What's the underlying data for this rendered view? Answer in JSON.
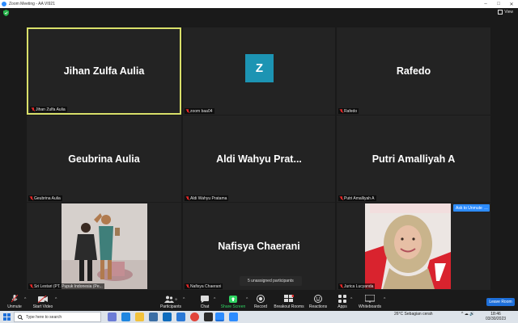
{
  "window": {
    "title": "Zoom Meeting - AA VI921"
  },
  "top": {
    "view_label": "View"
  },
  "tiles": [
    {
      "display_name": "Jihan Zulfa Aulia",
      "label": "Jihan Zulfa Aulia",
      "active": true
    },
    {
      "display_name": "Z",
      "label": "zoom baa04",
      "type": "avatar"
    },
    {
      "display_name": "Rafedo",
      "label": "Rafedo"
    },
    {
      "display_name": "Geubrina Aulia",
      "label": "Geubrina Aulia"
    },
    {
      "display_name": "Aldi Wahyu Prat...",
      "label": "Aldi Wahyu Pratama"
    },
    {
      "display_name": "Putri Amalliyah A",
      "label": "Putri Amalliyah A"
    },
    {
      "display_name": "",
      "label": "Sri Lestari (PT. Pupuk Indonesia (Pe...",
      "type": "video"
    },
    {
      "display_name": "Nafisya Chaerani",
      "label": "Nafisya Chaerani"
    },
    {
      "display_name": "",
      "label": "Jurica Lucyanda",
      "type": "video"
    }
  ],
  "overlay": {
    "ask_to_unmute": "Ask to Unmute",
    "more": "…",
    "unassigned": "5 unassigned participants"
  },
  "toolbar": {
    "unmute": "Unmute",
    "start_video": "Start Video",
    "participants": "Participants",
    "participants_count": "9",
    "chat": "Chat",
    "share_screen": "Share Screen",
    "record": "Record",
    "breakout_rooms": "Breakout Rooms",
    "reactions": "Reactions",
    "apps": "Apps",
    "whiteboards": "Whiteboards",
    "leave": "Leave Room",
    "caret": "^"
  },
  "taskbar": {
    "search_placeholder": "Type here to search",
    "weather": "26°C  Sebagian cerah",
    "time": "18:46",
    "date": "03/30/2023"
  },
  "colors": {
    "accent": "#2d8cff",
    "active_border": "#d9e06a",
    "share_green": "#2fd562",
    "avatar_teal": "#1c94b3",
    "muted_red": "#e02828"
  }
}
